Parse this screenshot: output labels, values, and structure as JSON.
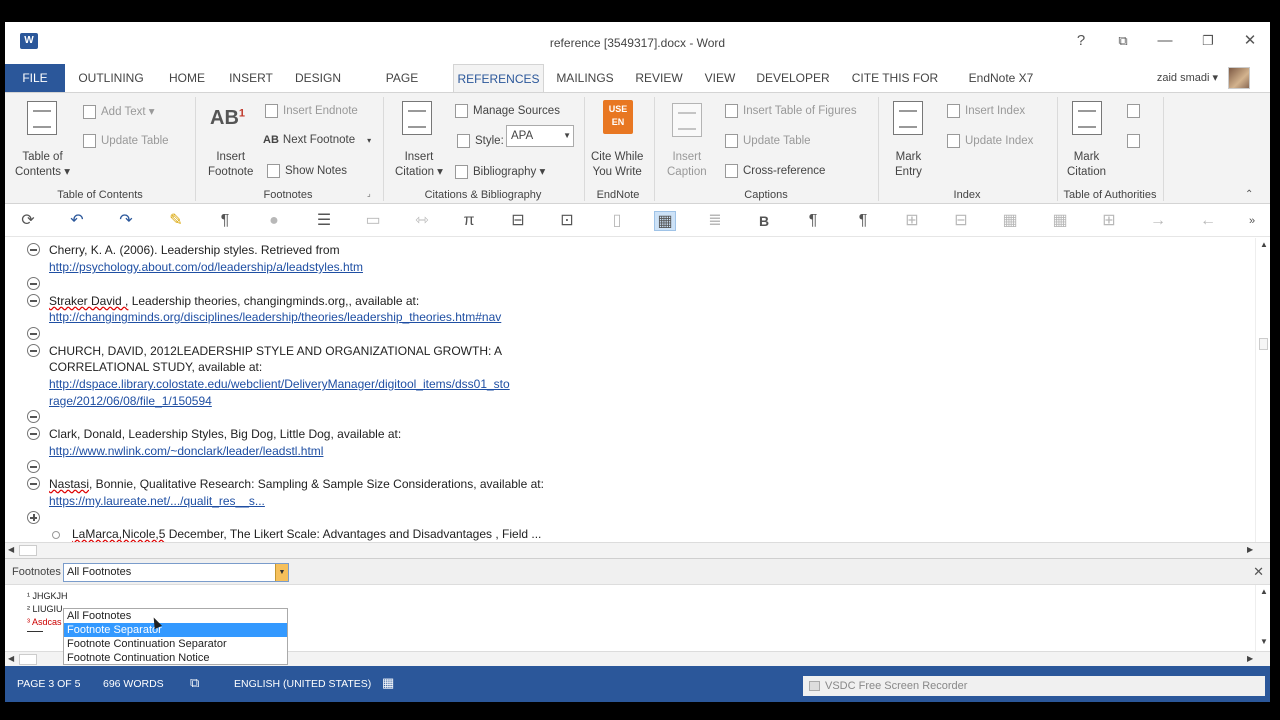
{
  "window": {
    "title": "reference [3549317].docx - Word",
    "app_icon": "W",
    "controls": {
      "help": "?",
      "restore_ribbon": "⧉",
      "minimize": "—",
      "maximize": "❐",
      "close": "✕"
    }
  },
  "tabs": [
    "FILE",
    "OUTLINING",
    "HOME",
    "INSERT",
    "DESIGN",
    "PAGE LAYOUT",
    "REFERENCES",
    "MAILINGS",
    "REVIEW",
    "VIEW",
    "DEVELOPER",
    "CITE THIS FOR ME",
    "EndNote X7"
  ],
  "active_tab": "REFERENCES",
  "user": {
    "name": "zaid smadi ▾"
  },
  "ribbon": {
    "toc": {
      "button": "Table of\nContents ▾",
      "add_text": "Add Text ▾",
      "update_table": "Update Table",
      "group": "Table of Contents"
    },
    "footnotes": {
      "insert_footnote": "Insert\nFootnote",
      "insert_endnote": "Insert Endnote",
      "next_footnote": "Next Footnote",
      "show_notes": "Show Notes",
      "group": "Footnotes"
    },
    "citations": {
      "insert_citation": "Insert\nCitation ▾",
      "manage_sources": "Manage Sources",
      "style_label": "Style:",
      "style_value": "APA",
      "bibliography": "Bibliography ▾",
      "group": "Citations & Bibliography"
    },
    "endnote": {
      "cite_while": "Cite While\nYou Write",
      "icon_text": "USE\nEN",
      "group": "EndNote"
    },
    "captions": {
      "insert_caption": "Insert\nCaption",
      "insert_tof": "Insert Table of Figures",
      "update_table": "Update Table",
      "cross_reference": "Cross-reference",
      "group": "Captions"
    },
    "index": {
      "mark_entry": "Mark\nEntry",
      "insert_index": "Insert Index",
      "update_index": "Update Index",
      "group": "Index"
    },
    "authorities": {
      "mark_citation": "Mark\nCitation",
      "group": "Table of Authorities"
    }
  },
  "document": {
    "entries": [
      {
        "text": "Cherry, K. A. (2006). Leadership styles. Retrieved from",
        "link": "http://psychology.about.com/od/leadership/a/leadstyles.htm"
      },
      {
        "text_a": "Straker David ,",
        "text_b": " Leadership theories, changingminds.org,, available at:",
        "link": "http://changingminds.org/disciplines/leadership/theories/leadership_theories.htm#nav"
      },
      {
        "text1": "CHURCH, DAVID, 2012LEADERSHIP STYLE AND ORGANIZATIONAL GROWTH: A",
        "text2": "CORRELATIONAL STUDY, available at:",
        "link1": "http://dspace.library.colostate.edu/webclient/DeliveryManager/digitool_items/dss01_sto",
        "link2": "rage/2012/06/08/file_1/150594"
      },
      {
        "text": "Clark, Donald, Leadership Styles, Big Dog, Little Dog, available at:",
        "link": "http://www.nwlink.com/~donclark/leader/leadstl.html"
      },
      {
        "text_a": "Nastasi",
        "text_b": ", Bonnie, Qualitative Research: Sampling & Sample Size Considerations, available at:",
        "link": "https://my.laureate.net/.../qualit_res__s..."
      },
      {
        "text_a": "LaMarca,Nicole,5",
        "text_b": " December, The Likert Scale: Advantages and Disadvantages , Field ..."
      }
    ]
  },
  "footnotes_pane": {
    "label": "Footnotes",
    "selected": "All Footnotes",
    "options": [
      "All Footnotes",
      "Footnote Separator",
      "Footnote Continuation Separator",
      "Footnote Continuation Notice"
    ],
    "highlighted": "Footnote Separator",
    "notes": [
      "¹ JHGKJH",
      "² LIUGIU",
      "³ Asdcas"
    ]
  },
  "status": {
    "page": "PAGE 3 OF 5",
    "words": "696 WORDS",
    "language": "ENGLISH (UNITED STATES)",
    "recorder": "VSDC Free Screen Recorder"
  },
  "colors": {
    "accent": "#2b579a",
    "link": "#1f4fa3",
    "selection": "#3399ff"
  }
}
